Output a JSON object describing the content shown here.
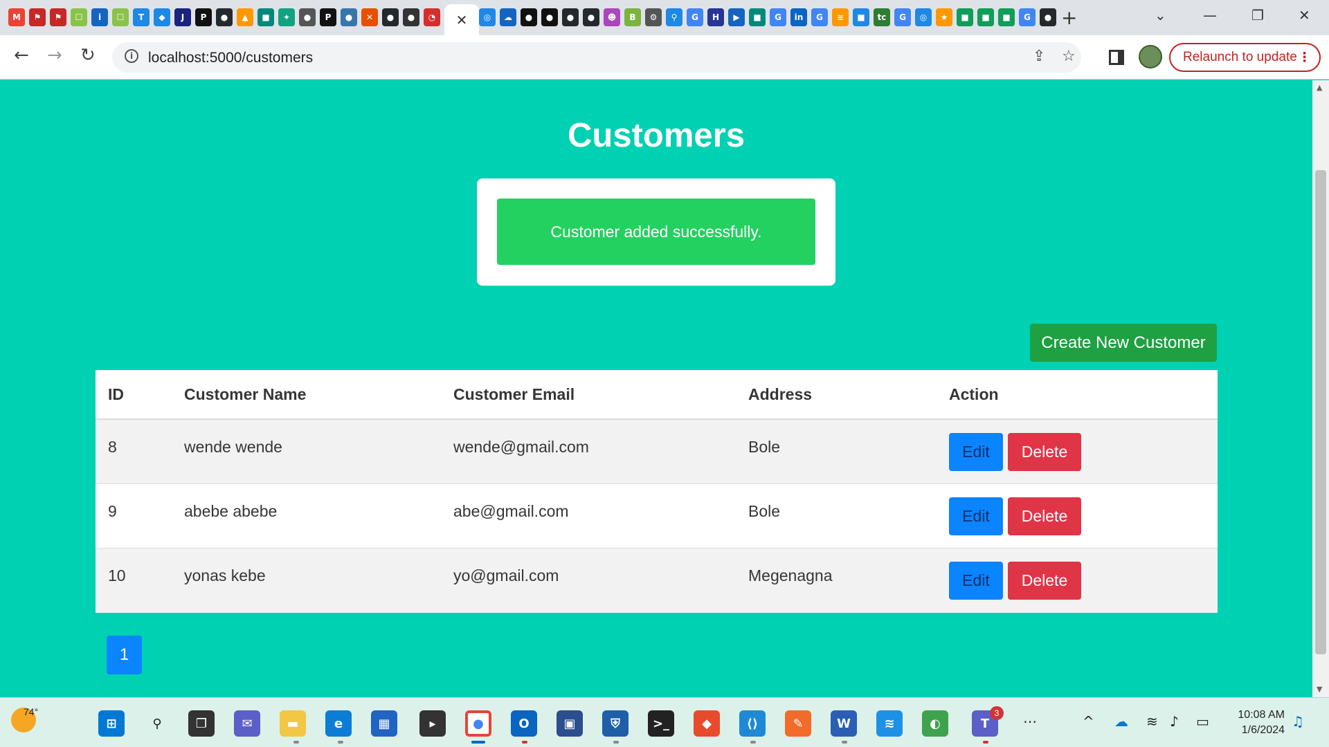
{
  "browser": {
    "url": "localhost:5000/customers",
    "relaunch_label": "Relaunch to update",
    "active_tab_close": "✕",
    "new_tab": "+",
    "pinned_tabs": [
      {
        "icon": "gmail-icon",
        "glyph": "M",
        "color": "#ea4335"
      },
      {
        "icon": "app-icon",
        "glyph": "⚑",
        "color": "#c62828"
      },
      {
        "icon": "app-icon",
        "glyph": "⚑",
        "color": "#c62828"
      },
      {
        "icon": "app-icon",
        "glyph": "☐",
        "color": "#8bc34a"
      },
      {
        "icon": "info-icon",
        "glyph": "i",
        "color": "#1565c0"
      },
      {
        "icon": "app-icon",
        "glyph": "☐",
        "color": "#8bc34a"
      },
      {
        "icon": "t-icon",
        "glyph": "T",
        "color": "#1e88e5"
      },
      {
        "icon": "diamond-icon",
        "glyph": "◆",
        "color": "#1e88e5"
      },
      {
        "icon": "j2c-icon",
        "glyph": "J",
        "color": "#1a237e"
      },
      {
        "icon": "p-icon",
        "glyph": "P",
        "color": "#111111"
      },
      {
        "icon": "github-icon",
        "glyph": "●",
        "color": "#24292e"
      },
      {
        "icon": "app-icon",
        "glyph": "▲",
        "color": "#ff9800"
      },
      {
        "icon": "meet-icon",
        "glyph": "■",
        "color": "#00897b"
      },
      {
        "icon": "chatgpt-icon",
        "glyph": "✦",
        "color": "#10a37f"
      },
      {
        "icon": "app-icon",
        "glyph": "●",
        "color": "#555555"
      },
      {
        "icon": "p-icon",
        "glyph": "P",
        "color": "#111111"
      },
      {
        "icon": "python-icon",
        "glyph": "●",
        "color": "#3776ab"
      },
      {
        "icon": "app-icon",
        "glyph": "✕",
        "color": "#e65100"
      },
      {
        "icon": "github-icon",
        "glyph": "●",
        "color": "#24292e"
      },
      {
        "icon": "app-icon",
        "glyph": "●",
        "color": "#333333"
      },
      {
        "icon": "app-icon",
        "glyph": "◔",
        "color": "#d32f2f"
      }
    ],
    "pinned_tabs_right": [
      {
        "icon": "app-icon",
        "glyph": "◎",
        "color": "#1e88e5"
      },
      {
        "icon": "cloud-icon",
        "glyph": "☁",
        "color": "#1565c0"
      },
      {
        "icon": "medium-icon",
        "glyph": "●",
        "color": "#111111"
      },
      {
        "icon": "medium-icon",
        "glyph": "●",
        "color": "#111111"
      },
      {
        "icon": "github-icon",
        "glyph": "●",
        "color": "#24292e"
      },
      {
        "icon": "github-icon",
        "glyph": "●",
        "color": "#24292e"
      },
      {
        "icon": "app-icon",
        "glyph": "☻",
        "color": "#ab47bc"
      },
      {
        "icon": "b64-icon",
        "glyph": "B",
        "color": "#7cb342"
      },
      {
        "icon": "app-icon",
        "glyph": "⚙",
        "color": "#555555"
      },
      {
        "icon": "app-icon",
        "glyph": "⚲",
        "color": "#1e88e5"
      },
      {
        "icon": "google-icon",
        "glyph": "G",
        "color": "#4285f4"
      },
      {
        "icon": "app-icon",
        "glyph": "H",
        "color": "#283593"
      },
      {
        "icon": "app-icon",
        "glyph": "▶",
        "color": "#1565c0"
      },
      {
        "icon": "meet-icon",
        "glyph": "■",
        "color": "#00897b"
      },
      {
        "icon": "google-icon",
        "glyph": "G",
        "color": "#4285f4"
      },
      {
        "icon": "linkedin-icon",
        "glyph": "in",
        "color": "#0a66c2"
      },
      {
        "icon": "google-icon",
        "glyph": "G",
        "color": "#4285f4"
      },
      {
        "icon": "app-icon",
        "glyph": "≋",
        "color": "#ff9800"
      },
      {
        "icon": "app-icon",
        "glyph": "■",
        "color": "#1e88e5"
      },
      {
        "icon": "app-icon",
        "glyph": "tc",
        "color": "#2e7d32"
      },
      {
        "icon": "google-icon",
        "glyph": "G",
        "color": "#4285f4"
      },
      {
        "icon": "app-icon",
        "glyph": "◎",
        "color": "#1e88e5"
      },
      {
        "icon": "app-icon",
        "glyph": "★",
        "color": "#ff9800"
      },
      {
        "icon": "sheets-icon",
        "glyph": "■",
        "color": "#0f9d58"
      },
      {
        "icon": "sheets-icon",
        "glyph": "■",
        "color": "#0f9d58"
      },
      {
        "icon": "sheets-icon",
        "glyph": "■",
        "color": "#0f9d58"
      },
      {
        "icon": "google-icon",
        "glyph": "G",
        "color": "#4285f4"
      },
      {
        "icon": "github-icon",
        "glyph": "●",
        "color": "#24292e"
      }
    ]
  },
  "page": {
    "title": "Customers",
    "notification": "Customer added successfully.",
    "create_button": "Create New Customer",
    "columns": [
      "ID",
      "Customer Name",
      "Customer Email",
      "Address",
      "Action"
    ],
    "rows": [
      {
        "id": "8",
        "name": "wende wende",
        "email": "wende@gmail.com",
        "address": "Bole"
      },
      {
        "id": "9",
        "name": "abebe abebe",
        "email": "abe@gmail.com",
        "address": "Bole"
      },
      {
        "id": "10",
        "name": "yonas kebe",
        "email": "yo@gmail.com",
        "address": "Megenagna"
      }
    ],
    "edit_label": "Edit",
    "delete_label": "Delete",
    "page_number": "1"
  },
  "taskbar": {
    "temperature": "74°",
    "time": "10:08 AM",
    "date": "1/6/2024",
    "teams_badge": "3",
    "more": "⋯"
  },
  "colors": {
    "page_bg": "#00d1b2",
    "success": "#23d160",
    "create": "#1ea043",
    "edit": "#0a84ff",
    "delete": "#e03447"
  }
}
